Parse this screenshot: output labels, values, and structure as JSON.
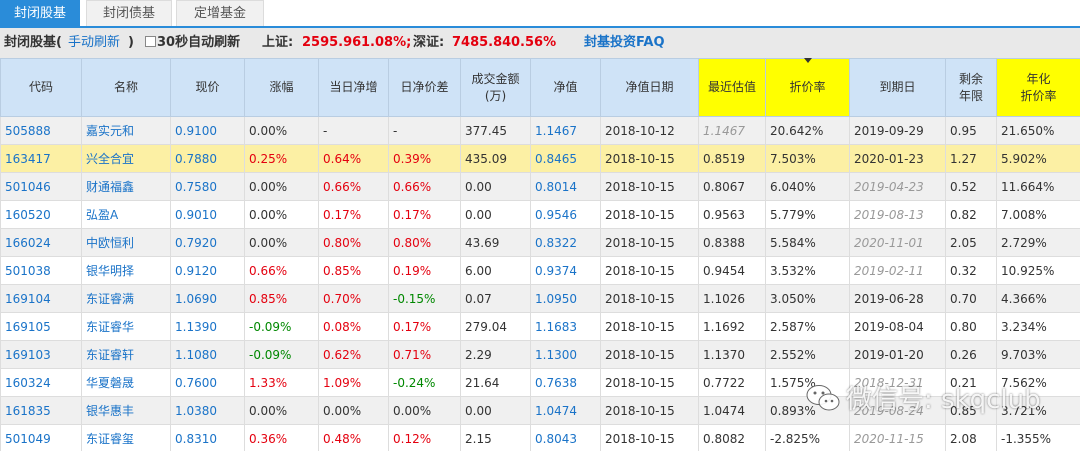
{
  "tabs": [
    {
      "label": "封闭股基",
      "active": true
    },
    {
      "label": "封闭债基",
      "active": false
    },
    {
      "label": "定增基金",
      "active": false
    }
  ],
  "toolbar": {
    "title": "封闭股基(",
    "manual_refresh": "手动刷新",
    "close_paren": ")",
    "auto_refresh_label": "30秒自动刷新",
    "sh_label": "上证:",
    "sh_index": "2595.96",
    "sh_change": "1.08%;",
    "sz_label": "深证:",
    "sz_index": "7485.84",
    "sz_change": "0.56%",
    "faq": "封基投资FAQ"
  },
  "columns": [
    "代码",
    "名称",
    "现价",
    "涨幅",
    "当日净增",
    "日净价差",
    "成交金额(万)",
    "净值",
    "净值日期",
    "最近估值",
    "折价率",
    "到期日",
    "剩余年限",
    "年化折价率"
  ],
  "col_lines": [
    [
      "代码"
    ],
    [
      "名称"
    ],
    [
      "现价"
    ],
    [
      "涨幅"
    ],
    [
      "当日净增"
    ],
    [
      "日净价差"
    ],
    [
      "成交金额",
      "(万)"
    ],
    [
      "净值"
    ],
    [
      "净值日期"
    ],
    [
      "最近估值"
    ],
    [
      "折价率"
    ],
    [
      "到期日"
    ],
    [
      "剩余",
      "年限"
    ],
    [
      "年化",
      "折价率"
    ]
  ],
  "rows": [
    [
      "505888",
      "嘉实元和",
      "0.9100",
      "0.00%",
      "-",
      "-",
      "377.45",
      "1.1467",
      "2018-10-12",
      "1.1467",
      "20.642%",
      "2019-09-29",
      "0.95",
      "21.650%"
    ],
    [
      "163417",
      "兴全合宜",
      "0.7880",
      "0.25%",
      "0.64%",
      "0.39%",
      "435.09",
      "0.8465",
      "2018-10-15",
      "0.8519",
      "7.503%",
      "2020-01-23",
      "1.27",
      "5.902%"
    ],
    [
      "501046",
      "财通福鑫",
      "0.7580",
      "0.00%",
      "0.66%",
      "0.66%",
      "0.00",
      "0.8014",
      "2018-10-15",
      "0.8067",
      "6.040%",
      "2019-04-23",
      "0.52",
      "11.664%"
    ],
    [
      "160520",
      "弘盈A",
      "0.9010",
      "0.00%",
      "0.17%",
      "0.17%",
      "0.00",
      "0.9546",
      "2018-10-15",
      "0.9563",
      "5.779%",
      "2019-08-13",
      "0.82",
      "7.008%"
    ],
    [
      "166024",
      "中欧恒利",
      "0.7920",
      "0.00%",
      "0.80%",
      "0.80%",
      "43.69",
      "0.8322",
      "2018-10-15",
      "0.8388",
      "5.584%",
      "2020-11-01",
      "2.05",
      "2.729%"
    ],
    [
      "501038",
      "银华明择",
      "0.9120",
      "0.66%",
      "0.85%",
      "0.19%",
      "6.00",
      "0.9374",
      "2018-10-15",
      "0.9454",
      "3.532%",
      "2019-02-11",
      "0.32",
      "10.925%"
    ],
    [
      "169104",
      "东证睿满",
      "1.0690",
      "0.85%",
      "0.70%",
      "-0.15%",
      "0.07",
      "1.0950",
      "2018-10-15",
      "1.1026",
      "3.050%",
      "2019-06-28",
      "0.70",
      "4.366%"
    ],
    [
      "169105",
      "东证睿华",
      "1.1390",
      "-0.09%",
      "0.08%",
      "0.17%",
      "279.04",
      "1.1683",
      "2018-10-15",
      "1.1692",
      "2.587%",
      "2019-08-04",
      "0.80",
      "3.234%"
    ],
    [
      "169103",
      "东证睿轩",
      "1.1080",
      "-0.09%",
      "0.62%",
      "0.71%",
      "2.29",
      "1.1300",
      "2018-10-15",
      "1.1370",
      "2.552%",
      "2019-01-20",
      "0.26",
      "9.703%"
    ],
    [
      "160324",
      "华夏磐晟",
      "0.7600",
      "1.33%",
      "1.09%",
      "-0.24%",
      "21.64",
      "0.7638",
      "2018-10-15",
      "0.7722",
      "1.575%",
      "2018-12-31",
      "0.21",
      "7.562%"
    ],
    [
      "161835",
      "银华惠丰",
      "1.0380",
      "0.00%",
      "0.00%",
      "0.00%",
      "0.00",
      "1.0474",
      "2018-10-15",
      "1.0474",
      "0.893%",
      "2019-08-24",
      "0.85",
      "3.721%"
    ],
    [
      "501049",
      "东证睿玺",
      "0.8310",
      "0.36%",
      "0.48%",
      "0.12%",
      "2.15",
      "0.8043",
      "2018-10-15",
      "0.8082",
      "-2.825%",
      "2020-11-15",
      "2.08",
      "-1.355%"
    ]
  ],
  "gray_date_rows": [
    2,
    3,
    4,
    5,
    9,
    10,
    11
  ],
  "highlight_row": 1,
  "watermark": "微信号: skqclub",
  "colors": {
    "accent": "#2a8cd9",
    "header_bg": "#cfe3f7",
    "highlight_col": "#ffff00",
    "selected_row": "#fcf0a4",
    "up": "#e4000f",
    "down": "#008800",
    "link": "#1a73c8"
  }
}
